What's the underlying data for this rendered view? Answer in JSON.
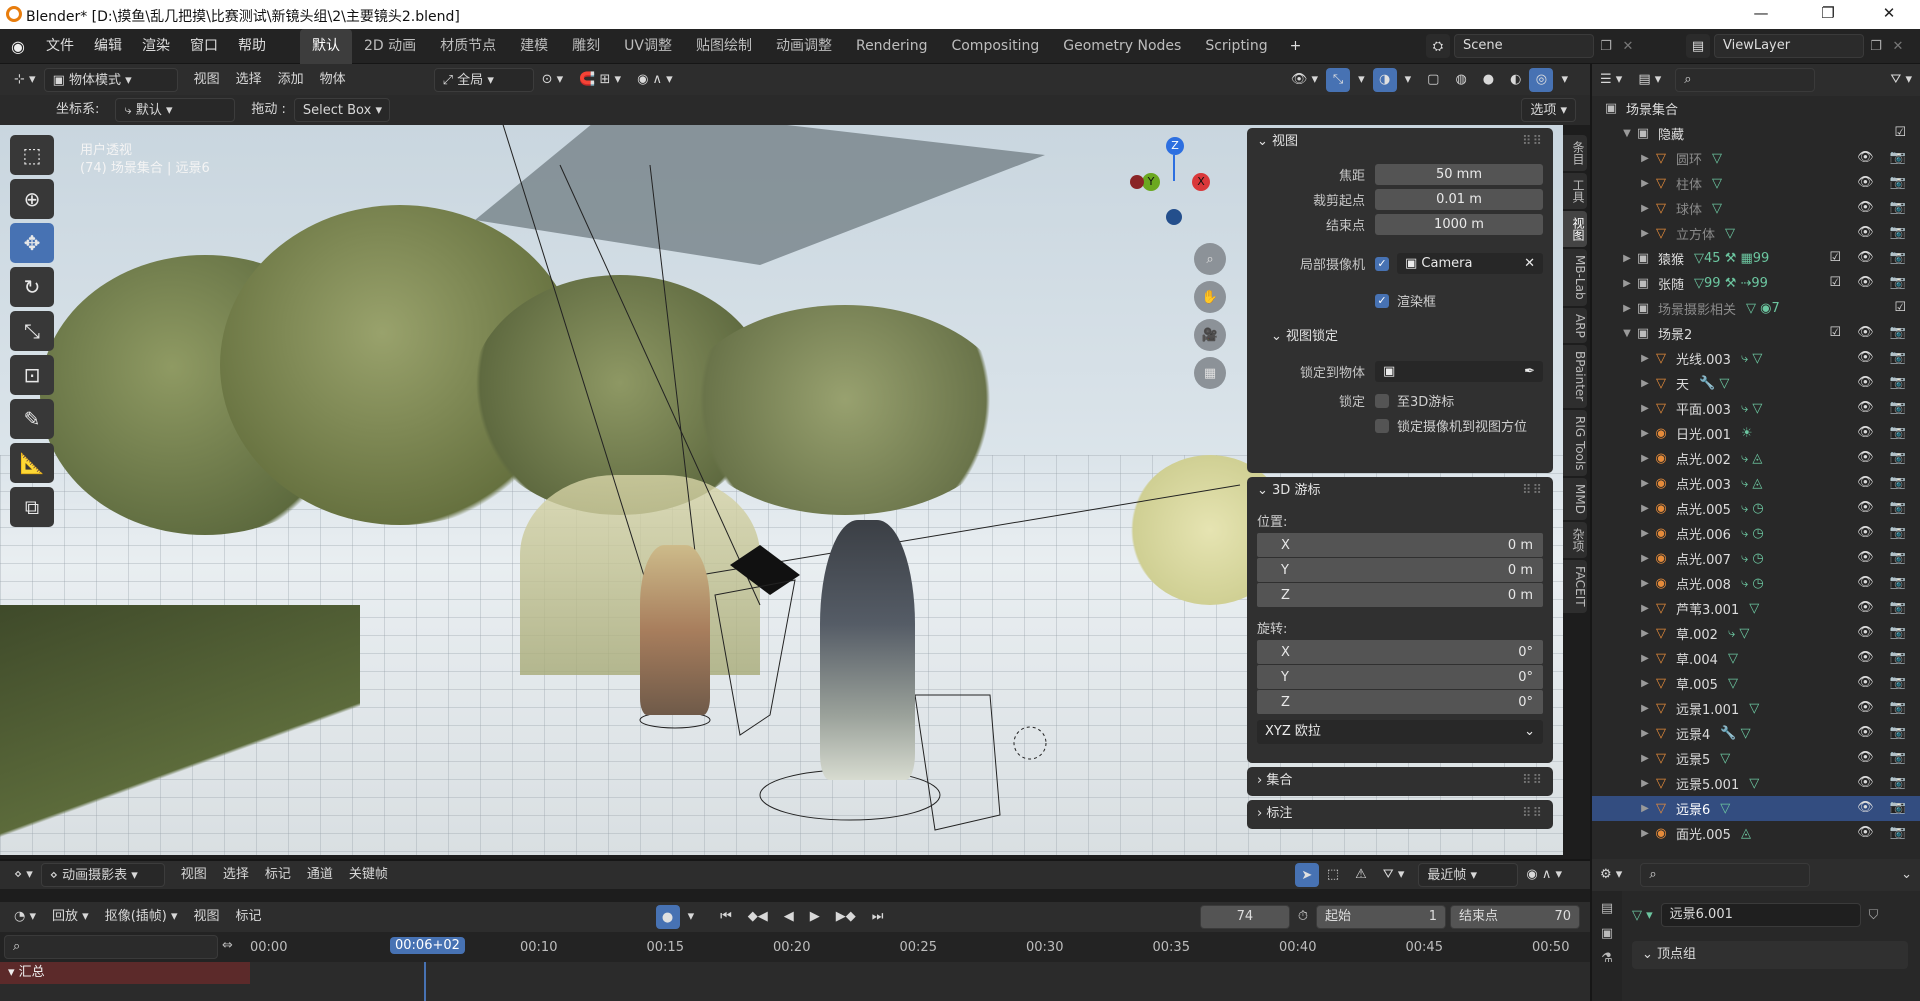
{
  "window": {
    "title": "Blender* [D:\\摸鱼\\乱几把摸\\比赛测试\\新镜头组\\2\\主要镜头2.blend]",
    "minimize": "—",
    "maximize": "❐",
    "close": "✕"
  },
  "menu": [
    "文件",
    "编辑",
    "渲染",
    "窗口",
    "帮助"
  ],
  "workspaces": [
    {
      "label": "默认",
      "active": true
    },
    {
      "label": "2D 动画"
    },
    {
      "label": "材质节点"
    },
    {
      "label": "建模"
    },
    {
      "label": "雕刻"
    },
    {
      "label": "UV调整"
    },
    {
      "label": "贴图绘制"
    },
    {
      "label": "动画调整"
    },
    {
      "label": "Rendering"
    },
    {
      "label": "Compositing"
    },
    {
      "label": "Geometry Nodes"
    },
    {
      "label": "Scripting"
    }
  ],
  "add_workspace": "+",
  "scene": {
    "name": "Scene",
    "viewlayer": "ViewLayer"
  },
  "viewport_header": {
    "mode": "物体模式",
    "menus": [
      "视图",
      "选择",
      "添加",
      "物体"
    ],
    "transform_orientation": "全局",
    "coord_label": "坐标系:",
    "coord_value": "默认",
    "drag_label": "拖动 :",
    "drag_value": "Select Box",
    "options": "选项"
  },
  "viewport_overlay": {
    "view_name": "用户透视",
    "collection_info": "(74) 场景集合 | 远景6"
  },
  "gizmo": {
    "z": "Z",
    "y": "Y",
    "x": "X"
  },
  "npanel": {
    "view": {
      "title": "视图",
      "focal_label": "焦距",
      "focal_value": "50 mm",
      "clip_start_label": "裁剪起点",
      "clip_start_value": "0.01 m",
      "clip_end_label": "结束点",
      "clip_end_value": "1000 m",
      "local_camera_label": "局部摄像机",
      "local_camera_value": "Camera",
      "render_region_label": "渲染框",
      "view_lock_title": "视图锁定",
      "lock_object_label": "锁定到物体",
      "lock_label": "锁定",
      "lock_3d_cursor": "至3D游标",
      "lock_camera_to_view": "锁定摄像机到视图方位"
    },
    "cursor": {
      "title": "3D 游标",
      "location_label": "位置:",
      "loc": [
        {
          "k": "X",
          "v": "0 m"
        },
        {
          "k": "Y",
          "v": "0 m"
        },
        {
          "k": "Z",
          "v": "0 m"
        }
      ],
      "rotation_label": "旋转:",
      "rot": [
        {
          "k": "X",
          "v": "0°"
        },
        {
          "k": "Y",
          "v": "0°"
        },
        {
          "k": "Z",
          "v": "0°"
        }
      ],
      "rotation_mode": "XYZ 欧拉"
    },
    "collection_title": "集合",
    "annotation_title": "标注"
  },
  "side_tabs": [
    "条目",
    "工具",
    "视图",
    "MB-Lab",
    "ARP",
    "BPainter",
    "RIG Tools",
    "MMD",
    "杂项",
    "FACEIT"
  ],
  "outliner": {
    "root": "场景集合",
    "rows": [
      {
        "indent": 1,
        "exp": "▼",
        "icon": "coll",
        "name": "隐藏",
        "dim": false,
        "mods": "",
        "check": true,
        "vis": ""
      },
      {
        "indent": 2,
        "exp": "▶",
        "icon": "tri",
        "name": "圆环",
        "dim": true,
        "mods": "▽",
        "vis": "👁 📷"
      },
      {
        "indent": 2,
        "exp": "▶",
        "icon": "tri",
        "name": "柱体",
        "dim": true,
        "mods": "▽",
        "vis": "👁 📷"
      },
      {
        "indent": 2,
        "exp": "▶",
        "icon": "tri",
        "name": "球体",
        "dim": true,
        "mods": "▽",
        "vis": "👁 📷"
      },
      {
        "indent": 2,
        "exp": "▶",
        "icon": "tri",
        "name": "立方体",
        "dim": true,
        "mods": "▽",
        "vis": "👁 📷"
      },
      {
        "indent": 1,
        "exp": "▶",
        "icon": "coll",
        "name": "猿猴",
        "dim": false,
        "mods": "▽45 ⚒ ▦99",
        "check": true,
        "vis": "👁 📷"
      },
      {
        "indent": 1,
        "exp": "▶",
        "icon": "coll",
        "name": "张随",
        "dim": false,
        "mods": "▽99 ⚒ ⇢99",
        "check": true,
        "vis": "👁 📷"
      },
      {
        "indent": 1,
        "exp": "▶",
        "icon": "coll",
        "name": "场景摄影相关",
        "dim": true,
        "mods": "▽ ◉7",
        "check": true,
        "vis": ""
      },
      {
        "indent": 1,
        "exp": "▼",
        "icon": "coll",
        "name": "场景2",
        "dim": false,
        "mods": "",
        "check": true,
        "vis": "👁 📷"
      },
      {
        "indent": 2,
        "exp": "▶",
        "icon": "tri",
        "name": "光线.003",
        "mods": "⤷ ▽",
        "vis": "👁 📷"
      },
      {
        "indent": 2,
        "exp": "▶",
        "icon": "tri",
        "name": "天",
        "mods": "🔧 ▽",
        "vis": "👁 📷"
      },
      {
        "indent": 2,
        "exp": "▶",
        "icon": "tri",
        "name": "平面.003",
        "mods": "⤷ ▽",
        "vis": "👁 📷"
      },
      {
        "indent": 2,
        "exp": "▶",
        "icon": "lamp",
        "name": "日光.001",
        "mods": "☀",
        "vis": "👁 📷"
      },
      {
        "indent": 2,
        "exp": "▶",
        "icon": "lamp",
        "name": "点光.002",
        "mods": "⤷ ◬",
        "vis": "👁 📷"
      },
      {
        "indent": 2,
        "exp": "▶",
        "icon": "lamp",
        "name": "点光.003",
        "mods": "⤷ ◬",
        "vis": "👁 📷"
      },
      {
        "indent": 2,
        "exp": "▶",
        "icon": "lamp",
        "name": "点光.005",
        "mods": "⤷ ◷",
        "vis": "👁 📷"
      },
      {
        "indent": 2,
        "exp": "▶",
        "icon": "lamp",
        "name": "点光.006",
        "mods": "⤷ ◷",
        "vis": "👁 📷"
      },
      {
        "indent": 2,
        "exp": "▶",
        "icon": "lamp",
        "name": "点光.007",
        "mods": "⤷ ◷",
        "vis": "👁 📷"
      },
      {
        "indent": 2,
        "exp": "▶",
        "icon": "lamp",
        "name": "点光.008",
        "mods": "⤷ ◷",
        "vis": "👁 📷"
      },
      {
        "indent": 2,
        "exp": "▶",
        "icon": "tri",
        "name": "芦苇3.001",
        "mods": "▽",
        "vis": "👁 📷"
      },
      {
        "indent": 2,
        "exp": "▶",
        "icon": "tri",
        "name": "草.002",
        "mods": "⤷ ▽",
        "vis": "👁 📷"
      },
      {
        "indent": 2,
        "exp": "▶",
        "icon": "tri",
        "name": "草.004",
        "mods": "▽",
        "vis": "👁 📷"
      },
      {
        "indent": 2,
        "exp": "▶",
        "icon": "tri",
        "name": "草.005",
        "mods": "▽",
        "vis": "👁 📷"
      },
      {
        "indent": 2,
        "exp": "▶",
        "icon": "tri",
        "name": "远景1.001",
        "mods": "▽",
        "vis": "👁 📷"
      },
      {
        "indent": 2,
        "exp": "▶",
        "icon": "tri",
        "name": "远景4",
        "mods": "🔧 ▽",
        "vis": "👁 📷"
      },
      {
        "indent": 2,
        "exp": "▶",
        "icon": "tri",
        "name": "远景5",
        "mods": "▽",
        "vis": "👁 📷"
      },
      {
        "indent": 2,
        "exp": "▶",
        "icon": "tri",
        "name": "远景5.001",
        "mods": "▽",
        "vis": "👁 📷"
      },
      {
        "indent": 2,
        "exp": "▶",
        "icon": "tri",
        "name": "远景6",
        "mods": "▽",
        "vis": "👁 📷",
        "selected": true
      },
      {
        "indent": 2,
        "exp": "▶",
        "icon": "lamp",
        "name": "面光.005",
        "mods": "◬",
        "vis": "👁 📷"
      }
    ]
  },
  "timeline": {
    "editor": "动画摄影表",
    "menus": [
      "视图",
      "选择",
      "标记",
      "通道",
      "关键帧"
    ],
    "interp": "最近帧",
    "playback": "回放",
    "keying": "抠像(插帧)",
    "view": "视图",
    "marker": "标记",
    "current_frame": "74",
    "start_label": "起始",
    "start_value": "1",
    "end_label": "结束点",
    "end_value": "70",
    "current_time": "00:06+02",
    "ticks": [
      "00:00",
      "00:10",
      "00:15",
      "00:20",
      "00:25",
      "00:30",
      "00:35",
      "00:40",
      "00:45",
      "00:50"
    ],
    "summary": "汇总"
  },
  "properties": {
    "object_name": "远景6.001",
    "vertex_groups": "顶点组"
  }
}
